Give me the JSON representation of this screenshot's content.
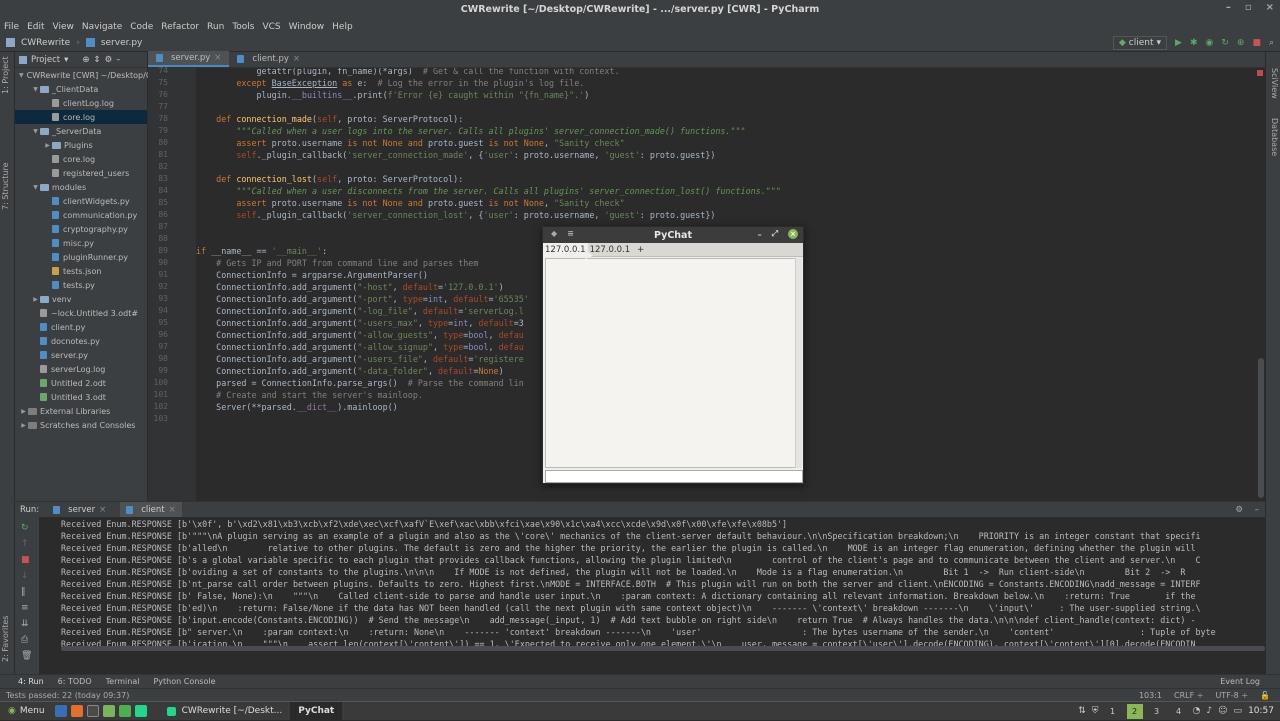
{
  "window": {
    "title": "CWRewrite [~/Desktop/CWRewrite] - .../server.py [CWR] - PyCharm"
  },
  "menu": [
    "File",
    "Edit",
    "View",
    "Navigate",
    "Code",
    "Refactor",
    "Run",
    "Tools",
    "VCS",
    "Window",
    "Help"
  ],
  "nav": {
    "project": "CWRewrite",
    "file": "server.py",
    "run_config": "client"
  },
  "left_strip": {
    "project": "1: Project",
    "structure": "7: Structure",
    "favorites": "2: Favorites"
  },
  "right_strip": {
    "sciview": "SciView",
    "database": "Database"
  },
  "project_panel": {
    "title": "Project",
    "items": [
      {
        "label": "CWRewrite [CWR] ~/Desktop/CWRewrite",
        "type": "folder",
        "arrow": "▼",
        "indent": 0
      },
      {
        "label": "_ClientData",
        "type": "folder",
        "arrow": "▼",
        "indent": 1
      },
      {
        "label": "clientLog.log",
        "type": "log",
        "arrow": "",
        "indent": 2
      },
      {
        "label": "core.log",
        "type": "log",
        "arrow": "",
        "indent": 2,
        "selected": true
      },
      {
        "label": "_ServerData",
        "type": "folder",
        "arrow": "▼",
        "indent": 1
      },
      {
        "label": "Plugins",
        "type": "folder",
        "arrow": "▶",
        "indent": 2
      },
      {
        "label": "core.log",
        "type": "log",
        "arrow": "",
        "indent": 2
      },
      {
        "label": "registered_users",
        "type": "log",
        "arrow": "",
        "indent": 2
      },
      {
        "label": "modules",
        "type": "folder",
        "arrow": "▼",
        "indent": 1
      },
      {
        "label": "clientWidgets.py",
        "type": "py",
        "arrow": "",
        "indent": 2
      },
      {
        "label": "communication.py",
        "type": "py",
        "arrow": "",
        "indent": 2
      },
      {
        "label": "cryptography.py",
        "type": "py",
        "arrow": "",
        "indent": 2
      },
      {
        "label": "misc.py",
        "type": "py",
        "arrow": "",
        "indent": 2
      },
      {
        "label": "pluginRunner.py",
        "type": "py",
        "arrow": "",
        "indent": 2
      },
      {
        "label": "tests.json",
        "type": "json",
        "arrow": "",
        "indent": 2
      },
      {
        "label": "tests.py",
        "type": "py",
        "arrow": "",
        "indent": 2
      },
      {
        "label": "venv",
        "type": "folder",
        "arrow": "▶",
        "indent": 1
      },
      {
        "label": "~lock.Untitled 3.odt#",
        "type": "log",
        "arrow": "",
        "indent": 1
      },
      {
        "label": "client.py",
        "type": "py",
        "arrow": "",
        "indent": 1
      },
      {
        "label": "docnotes.py",
        "type": "py",
        "arrow": "",
        "indent": 1
      },
      {
        "label": "server.py",
        "type": "py",
        "arrow": "",
        "indent": 1
      },
      {
        "label": "serverLog.log",
        "type": "log",
        "arrow": "",
        "indent": 1
      },
      {
        "label": "Untitled 2.odt",
        "type": "odt",
        "arrow": "",
        "indent": 1
      },
      {
        "label": "Untitled 3.odt",
        "type": "odt",
        "arrow": "",
        "indent": 1
      },
      {
        "label": "External Libraries",
        "type": "lib",
        "arrow": "▶",
        "indent": 0
      },
      {
        "label": "Scratches and Consoles",
        "type": "lib",
        "arrow": "▶",
        "indent": 0
      }
    ]
  },
  "editor": {
    "tabs": [
      {
        "label": "server.py",
        "active": true
      },
      {
        "label": "client.py",
        "active": false
      }
    ],
    "line_numbers": [
      "74",
      "75",
      "76",
      "77",
      "78",
      "79",
      "80",
      "81",
      "82",
      "83",
      "84",
      "85",
      "86",
      "87",
      "88",
      "89",
      "90",
      "91",
      "92",
      "93",
      "94",
      "95",
      "96",
      "97",
      "98",
      "99",
      "100",
      "101",
      "102",
      "103"
    ]
  },
  "pychat": {
    "title": "PyChat",
    "tabs": [
      "127.0.0.1",
      "127.0.0.1",
      "+"
    ]
  },
  "run": {
    "label": "Run:",
    "tabs": [
      "server",
      "client"
    ],
    "output": [
      "Received Enum.RESPONSE [b'\\x0f', b'\\xd2\\x81\\xb3\\xcb\\xf2\\xde\\xec\\xcf\\xafV`E\\xef\\xac\\xbb\\xfci\\xae\\x90\\x1c\\xa4\\xcc\\xcde\\x9d\\x0f\\x00\\xfe\\xfe\\x08b5']",
      "Received Enum.RESPONSE [b'\"\"\"\\nA plugin serving as an example of a plugin and also as the \\'core\\' mechanics of the client-server default behaviour.\\n\\nSpecification breakdown;\\n    PRIORITY is an integer constant that specifi",
      "Received Enum.RESPONSE [b'alled\\n        relative to other plugins. The default is zero and the higher the priority, the earlier the plugin is called.\\n    MODE is an integer flag enumeration, defining whether the plugin will",
      "Received Enum.RESPONSE [b's a global variable specific to each plugin that provides callback functions, allowing the plugin limited\\n        control of the client's page and to communicate between the client and server.\\n    C",
      "Received Enum.RESPONSE [b'oviding a set of constants to the plugins.\\n\\n\\n    If MODE is not defined, the plugin will not be loaded.\\n    Mode is a flag enumeration.\\n        Bit 1  ->  Run client-side\\n        Bit 2  ->  R",
      "Received Enum.RESPONSE [b'nt_parse call order between plugins. Defaults to zero. Highest first.\\nMODE = INTERFACE.BOTH  # This plugin will run on both the server and client.\\nENCODING = Constants.ENCODING\\nadd_message = INTERF",
      "Received Enum.RESPONSE [b' False, None):\\n    \"\"\"\\n    Called client-side to parse and handle user input.\\n    :param context: A dictionary containing all relevant information. Breakdown below.\\n    :return: True       if the",
      "Received Enum.RESPONSE [b'ed)\\n    :return: False/None if the data has NOT been handled (call the next plugin with same context object)\\n    ------- \\'context\\' breakdown -------\\n    \\'input\\'     : The user-supplied string.\\",
      "Received Enum.RESPONSE [b'input.encode(Constants.ENCODING))  # Send the message\\n    add_message(_input, 1)  # Add text bubble on right side\\n    return True  # Always handles the data.\\n\\n\\ndef client_handle(context: dict) -",
      "Received Enum.RESPONSE [b\" server.\\n    :param context:\\n    :return: None\\n    ------- 'context' breakdown -------\\n    'user'                    : The bytes username of the sender.\\n    'content'                 : Tuple of byte",
      "Received Enum.RESPONSE [b'ication.\\n    \"\"\"\\n    assert len(context[\\'content\\']) == 1, \\'Expected to receive only one element.\\'\\n    user, message = context[\\'user\\'].decode(ENCODING), context[\\'content\\'][0].decode(ENCODIN"
    ]
  },
  "bottom_tabs": {
    "run": "4: Run",
    "todo": "6: TODO",
    "terminal": "Terminal",
    "console": "Python Console",
    "event_log": "Event Log"
  },
  "status": {
    "message": "Tests passed: 22 (today 09:37)",
    "position": "103:1",
    "line_sep": "CRLF ÷",
    "encoding": "UTF-8 ÷"
  },
  "taskbar": {
    "menu": "Menu",
    "window1": "CWRewrite [~/Deskt...",
    "window2": "PyChat",
    "workspaces": [
      "1",
      "2",
      "3",
      "4"
    ],
    "clock": "10:57"
  },
  "colors": {
    "accent": "#4a88c7",
    "run_green": "#59a869",
    "stop_red": "#c75450",
    "mint_green": "#8ab854"
  }
}
